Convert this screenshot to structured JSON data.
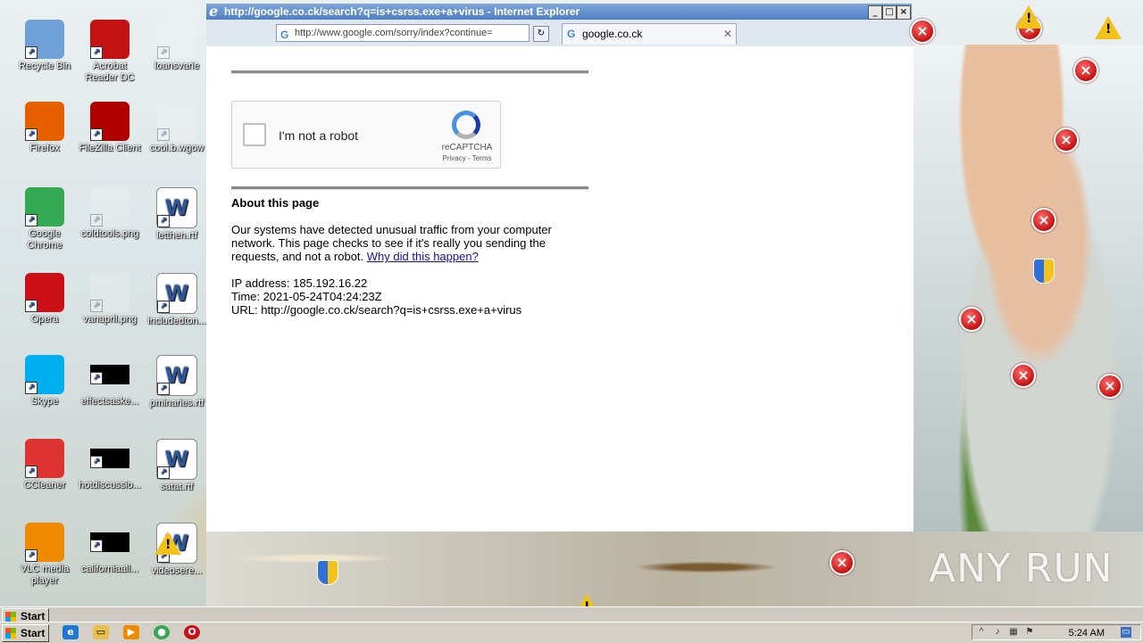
{
  "window": {
    "title": "http://google.co.ck/search?q=is+csrss.exe+a+virus - Internet Explorer",
    "address": "http://www.google.com/sorry/index?continue=",
    "tab_label": "google.co.ck"
  },
  "desktop_icons": [
    {
      "label": "Recycle Bin",
      "icon": "recycle-bin-icon",
      "color": "#6fa0d8"
    },
    {
      "label": "Acrobat Reader DC",
      "icon": "acrobat-icon",
      "color": "#c41212"
    },
    {
      "label": "loansvarie",
      "icon": "blank-file-icon",
      "color": "#f2f2f2"
    },
    {
      "label": "Firefox",
      "icon": "firefox-icon",
      "color": "#e66000"
    },
    {
      "label": "FileZilla Client",
      "icon": "filezilla-icon",
      "color": "#b00000"
    },
    {
      "label": "cool.b.wgow",
      "icon": "blank-file-icon",
      "color": "#f2f2f2"
    },
    {
      "label": "Google Chrome",
      "icon": "chrome-icon",
      "color": "#34a853"
    },
    {
      "label": "coldtools.png",
      "icon": "image-file-icon",
      "color": "#f2f2f2"
    },
    {
      "label": "letthen.rtf",
      "icon": "word-doc-icon",
      "color": "#2b579a"
    },
    {
      "label": "Opera",
      "icon": "opera-icon",
      "color": "#cc0f16"
    },
    {
      "label": "vanapril.png",
      "icon": "image-file-icon",
      "color": "#f2f2f2"
    },
    {
      "label": "includedton...",
      "icon": "word-doc-icon",
      "color": "#2b579a"
    },
    {
      "label": "Skype",
      "icon": "skype-icon",
      "color": "#00aff0"
    },
    {
      "label": "effectsaske...",
      "icon": "black-file-icon",
      "color": "#000000"
    },
    {
      "label": "pminaries.rtf",
      "icon": "word-doc-icon",
      "color": "#2b579a"
    },
    {
      "label": "CCleaner",
      "icon": "ccleaner-icon",
      "color": "#d33"
    },
    {
      "label": "hotdiscussio...",
      "icon": "black-file-icon",
      "color": "#000000"
    },
    {
      "label": "satat.rtf",
      "icon": "word-doc-icon",
      "color": "#2b579a"
    },
    {
      "label": "VLC media player",
      "icon": "vlc-icon",
      "color": "#f08a00"
    },
    {
      "label": "californiaall...",
      "icon": "black-file-icon",
      "color": "#000000"
    },
    {
      "label": "videosere...",
      "icon": "word-doc-icon",
      "color": "#2b579a"
    }
  ],
  "captcha": {
    "checkbox_label": "I'm not a robot",
    "brand": "reCAPTCHA",
    "privacy": "Privacy",
    "separator": " - ",
    "terms": "Terms"
  },
  "about": {
    "title": "About this page",
    "body": "Our systems have detected unusual traffic from your computer network. This page checks to see if it's really you sending the requests, and not a robot.",
    "link": "Why did this happen?"
  },
  "details": {
    "ip": "IP address: 185.192.16.22",
    "time": "Time: 2021-05-24T04:24:23Z",
    "url": "URL: http://google.co.ck/search?q=is+csrss.exe+a+virus"
  },
  "taskbar": {
    "start_label": "Start",
    "ghost_start_label": "Start",
    "clock": "5:24 AM"
  },
  "watermark": "ANY RUN"
}
